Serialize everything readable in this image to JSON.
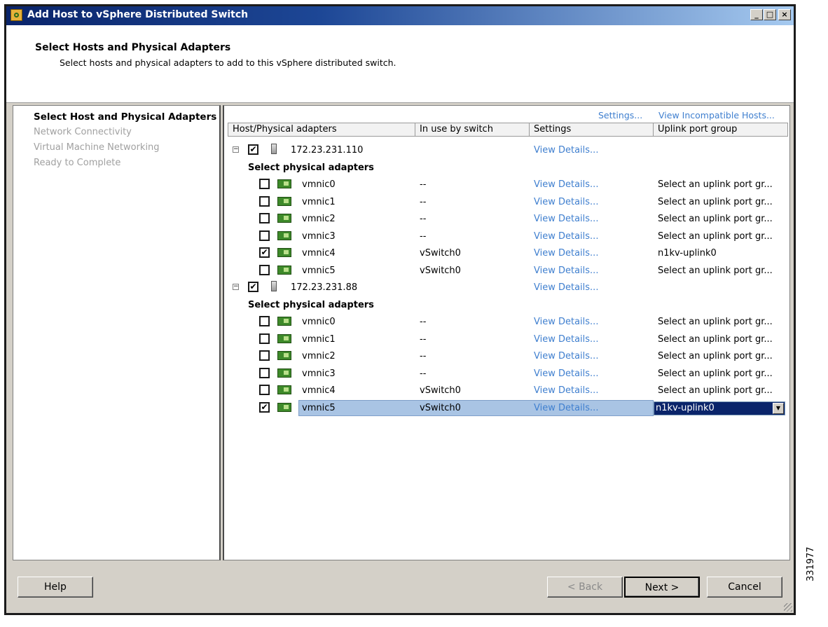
{
  "window": {
    "title": "Add Host to vSphere Distributed Switch",
    "controls": {
      "minimize": "_",
      "maximize": "□",
      "close": "×"
    }
  },
  "header": {
    "title": "Select Hosts and Physical Adapters",
    "subtitle": "Select hosts and physical adapters to add to this vSphere distributed switch."
  },
  "steps": [
    {
      "label": "Select Host and Physical Adapters",
      "active": true
    },
    {
      "label": "Network Connectivity",
      "active": false
    },
    {
      "label": "Virtual Machine Networking",
      "active": false
    },
    {
      "label": "Ready to Complete",
      "active": false
    }
  ],
  "toolbar": {
    "settings_link": "Settings...",
    "incompatible_link": "View Incompatible Hosts..."
  },
  "columns": [
    "Host/Physical adapters",
    "In use by switch",
    "Settings",
    "Uplink port group"
  ],
  "hosts": [
    {
      "ip": "172.23.231.110",
      "checked": true,
      "settings": "View Details...",
      "subheading": "Select physical adapters",
      "adapters": [
        {
          "name": "vmnic0",
          "switch": "--",
          "settings": "View Details...",
          "uplink": "Select an uplink port gr...",
          "checked": false
        },
        {
          "name": "vmnic1",
          "switch": "--",
          "settings": "View Details...",
          "uplink": "Select an uplink port gr...",
          "checked": false
        },
        {
          "name": "vmnic2",
          "switch": "--",
          "settings": "View Details...",
          "uplink": "Select an uplink port gr...",
          "checked": false
        },
        {
          "name": "vmnic3",
          "switch": "--",
          "settings": "View Details...",
          "uplink": "Select an uplink port gr...",
          "checked": false
        },
        {
          "name": "vmnic4",
          "switch": "vSwitch0",
          "settings": "View Details...",
          "uplink": "n1kv-uplink0",
          "checked": true
        },
        {
          "name": "vmnic5",
          "switch": "vSwitch0",
          "settings": "View Details...",
          "uplink": "Select an uplink port gr...",
          "checked": false
        }
      ]
    },
    {
      "ip": "172.23.231.88",
      "checked": true,
      "settings": "View Details...",
      "subheading": "Select physical adapters",
      "adapters": [
        {
          "name": "vmnic0",
          "switch": "--",
          "settings": "View Details...",
          "uplink": "Select an uplink port gr...",
          "checked": false
        },
        {
          "name": "vmnic1",
          "switch": "--",
          "settings": "View Details...",
          "uplink": "Select an uplink port gr...",
          "checked": false
        },
        {
          "name": "vmnic2",
          "switch": "--",
          "settings": "View Details...",
          "uplink": "Select an uplink port gr...",
          "checked": false
        },
        {
          "name": "vmnic3",
          "switch": "--",
          "settings": "View Details...",
          "uplink": "Select an uplink port gr...",
          "checked": false
        },
        {
          "name": "vmnic4",
          "switch": "vSwitch0",
          "settings": "View Details...",
          "uplink": "Select an uplink port gr...",
          "checked": false
        },
        {
          "name": "vmnic5",
          "switch": "vSwitch0",
          "settings": "View Details...",
          "uplink": "n1kv-uplink0",
          "checked": true,
          "selected": true
        }
      ]
    }
  ],
  "buttons": {
    "help": "Help",
    "back": "< Back",
    "next": "Next >",
    "cancel": "Cancel"
  },
  "figure_id": "331977",
  "colors": {
    "link": "#3f7fcf",
    "selection": "#a9c4e4",
    "dropdown_selected": "#0a246a"
  }
}
